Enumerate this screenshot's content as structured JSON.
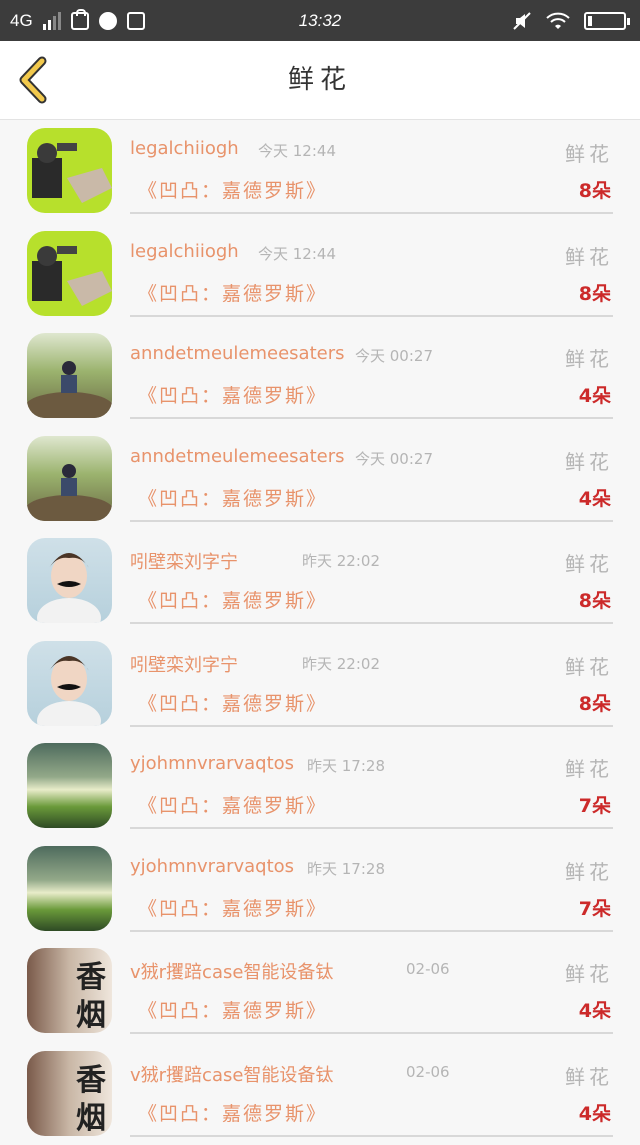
{
  "status_bar": {
    "network": "4G",
    "time": "13:32"
  },
  "header": {
    "title": "鲜花"
  },
  "records": [
    {
      "user": "legalchiiogh",
      "time": "今天 12:44",
      "tag": "鲜花",
      "work": "《凹凸：嘉德罗斯》",
      "count": "8朵",
      "avatar": "robot-avatar"
    },
    {
      "user": "legalchiiogh",
      "time": "今天 12:44",
      "tag": "鲜花",
      "work": "《凹凸：嘉德罗斯》",
      "count": "8朵",
      "avatar": "robot-avatar"
    },
    {
      "user": "anndetmeulemeesaters",
      "time": "今天 00:27",
      "tag": "鲜花",
      "work": "《凹凸：嘉德罗斯》",
      "count": "4朵",
      "avatar": "boy-on-rock-avatar"
    },
    {
      "user": "anndetmeulemeesaters",
      "time": "今天 00:27",
      "tag": "鲜花",
      "work": "《凹凸：嘉德罗斯》",
      "count": "4朵",
      "avatar": "boy-on-rock-avatar"
    },
    {
      "user": "吲壁栾刘字宁",
      "time": "昨天 22:02",
      "tag": "鲜花",
      "work": "《凹凸：嘉德罗斯》",
      "count": "8朵",
      "avatar": "mustache-kid-avatar"
    },
    {
      "user": "吲壁栾刘字宁",
      "time": "昨天 22:02",
      "tag": "鲜花",
      "work": "《凹凸：嘉德罗斯》",
      "count": "8朵",
      "avatar": "mustache-kid-avatar"
    },
    {
      "user": "yjohmnvrarvaqtos",
      "time": "昨天 17:28",
      "tag": "鲜花",
      "work": "《凹凸：嘉德罗斯》",
      "count": "7朵",
      "avatar": "field-avatar"
    },
    {
      "user": "yjohmnvrarvaqtos",
      "time": "昨天 17:28",
      "tag": "鲜花",
      "work": "《凹凸：嘉德罗斯》",
      "count": "7朵",
      "avatar": "field-avatar"
    },
    {
      "user": "v狨r攫踣case智能设备钛",
      "time": "02-06",
      "tag": "鲜花",
      "work": "《凹凸：嘉德罗斯》",
      "count": "4朵",
      "avatar": "xiangyan-avatar",
      "avatar_text": [
        "香",
        "烟"
      ]
    },
    {
      "user": "v狨r攫踣case智能设备钛",
      "time": "02-06",
      "tag": "鲜花",
      "work": "《凹凸：嘉德罗斯》",
      "count": "4朵",
      "avatar": "xiangyan-avatar",
      "avatar_text": [
        "香",
        "烟"
      ]
    }
  ],
  "colors": {
    "accent": "#e8936b",
    "count": "#cc2a2a",
    "muted": "#b5b5b5",
    "back_arrow": "#f2c94c"
  }
}
